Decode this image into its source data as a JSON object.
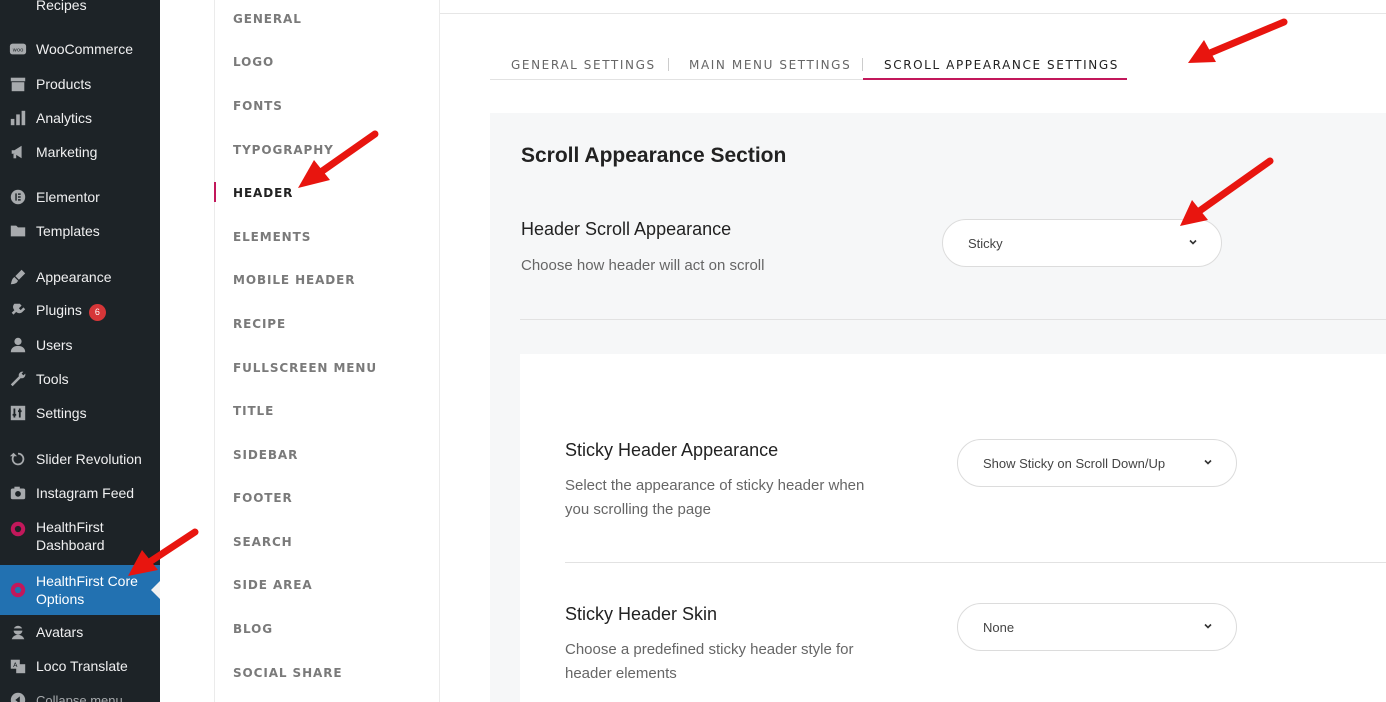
{
  "wp_menu": {
    "items": [
      {
        "label": "Recipes",
        "icon": "recipes-icon"
      },
      {
        "label": "WooCommerce",
        "icon": "woocommerce-icon"
      },
      {
        "label": "Products",
        "icon": "products-icon"
      },
      {
        "label": "Analytics",
        "icon": "analytics-icon"
      },
      {
        "label": "Marketing",
        "icon": "megaphone-icon"
      },
      {
        "label": "Elementor",
        "icon": "elementor-icon"
      },
      {
        "label": "Templates",
        "icon": "folder-icon"
      },
      {
        "label": "Appearance",
        "icon": "paintbrush-icon"
      },
      {
        "label": "Plugins",
        "icon": "plugin-icon",
        "badge": "6"
      },
      {
        "label": "Users",
        "icon": "users-icon"
      },
      {
        "label": "Tools",
        "icon": "wrench-icon"
      },
      {
        "label": "Settings",
        "icon": "settings-sliders-icon"
      },
      {
        "label": "Slider Revolution",
        "icon": "slider-revolution-icon"
      },
      {
        "label": "Instagram Feed",
        "icon": "camera-icon"
      },
      {
        "label": "HealthFirst Dashboard",
        "icon": "healthfirst-icon"
      },
      {
        "label": "HealthFirst Core Options",
        "icon": "healthfirst-options-icon"
      },
      {
        "label": "Avatars",
        "icon": "avatar-icon"
      },
      {
        "label": "Loco Translate",
        "icon": "translate-icon"
      },
      {
        "label": "Collapse menu",
        "icon": "collapse-icon"
      }
    ]
  },
  "options_nav": {
    "items": [
      "GENERAL",
      "LOGO",
      "FONTS",
      "TYPOGRAPHY",
      "HEADER",
      "ELEMENTS",
      "MOBILE HEADER",
      "RECIPE",
      "FULLSCREEN MENU",
      "TITLE",
      "SIDEBAR",
      "FOOTER",
      "SEARCH",
      "SIDE AREA",
      "BLOG",
      "SOCIAL SHARE"
    ],
    "selected": "HEADER"
  },
  "tabs": [
    "GENERAL SETTINGS",
    "MAIN MENU SETTINGS",
    "SCROLL APPEARANCE SETTINGS"
  ],
  "section": {
    "title": "Scroll Appearance Section",
    "header_scroll": {
      "label": "Header Scroll Appearance",
      "desc": "Choose how header will act on scroll",
      "value": "Sticky"
    },
    "sticky_appearance": {
      "label": "Sticky Header Appearance",
      "desc_line1": "Select the appearance of sticky header when",
      "desc_line2": "you scrolling the page",
      "value": "Show Sticky on Scroll Down/Up"
    },
    "sticky_skin": {
      "label": "Sticky Header Skin",
      "desc_line1": "Choose a predefined sticky header style for",
      "desc_line2": "header elements",
      "value": "None"
    }
  },
  "colors": {
    "accent": "#c2185b",
    "wp_active": "#2271b1",
    "annotation_arrow": "#e8150f"
  }
}
